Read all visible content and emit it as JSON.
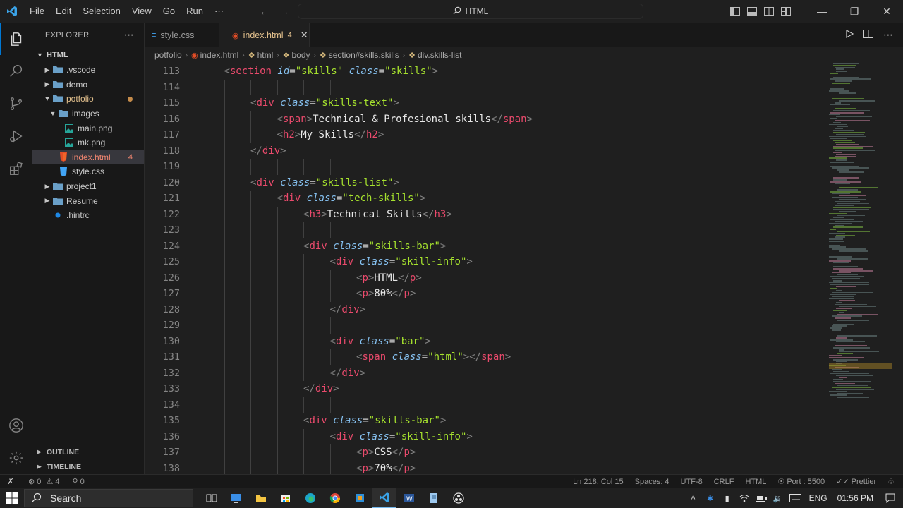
{
  "menu": [
    "File",
    "Edit",
    "Selection",
    "View",
    "Go",
    "Run",
    "···"
  ],
  "command_center": "HTML",
  "explorer": {
    "header": "EXPLORER",
    "root": "HTML",
    "items": [
      {
        "label": ".vscode",
        "type": "folder",
        "depth": 1,
        "expanded": false
      },
      {
        "label": "demo",
        "type": "folder",
        "depth": 1,
        "expanded": false
      },
      {
        "label": "potfolio",
        "type": "folder",
        "depth": 1,
        "expanded": true,
        "status": "modified"
      },
      {
        "label": "images",
        "type": "folder",
        "depth": 2,
        "expanded": true
      },
      {
        "label": "main.png",
        "type": "image",
        "depth": 3
      },
      {
        "label": "mk.png",
        "type": "image",
        "depth": 3
      },
      {
        "label": "index.html",
        "type": "html",
        "depth": 2,
        "badge": "4",
        "status": "error"
      },
      {
        "label": "style.css",
        "type": "css",
        "depth": 2
      },
      {
        "label": "project1",
        "type": "folder",
        "depth": 1,
        "expanded": false
      },
      {
        "label": "Resume",
        "type": "folder",
        "depth": 1,
        "expanded": false
      },
      {
        "label": ".hintrc",
        "type": "config",
        "depth": 1
      }
    ],
    "outline": "OUTLINE",
    "timeline": "TIMELINE"
  },
  "tabs": [
    {
      "label": "style.css",
      "active": false
    },
    {
      "label": "index.html",
      "count": "4",
      "active": true
    }
  ],
  "breadcrumb": [
    "potfolio",
    "index.html",
    "html",
    "body",
    "section#skills.skills",
    "div.skills-list"
  ],
  "code_lines": [
    {
      "n": "113",
      "indent": 1,
      "tokens": [
        [
          "b",
          "<"
        ],
        [
          "t",
          "section"
        ],
        [
          "s",
          " "
        ],
        [
          "a",
          "id"
        ],
        [
          "e",
          "="
        ],
        [
          "v",
          "\"skills\""
        ],
        [
          "s",
          " "
        ],
        [
          "a",
          "class"
        ],
        [
          "e",
          "="
        ],
        [
          "v",
          "\"skills\""
        ],
        [
          "b",
          ">"
        ]
      ]
    },
    {
      "n": "114",
      "indent": 0,
      "tokens": []
    },
    {
      "n": "115",
      "indent": 2,
      "tokens": [
        [
          "b",
          "<"
        ],
        [
          "t",
          "div"
        ],
        [
          "s",
          " "
        ],
        [
          "a",
          "class"
        ],
        [
          "e",
          "="
        ],
        [
          "v",
          "\"skills-text\""
        ],
        [
          "b",
          ">"
        ]
      ]
    },
    {
      "n": "116",
      "indent": 3,
      "tokens": [
        [
          "b",
          "<"
        ],
        [
          "t",
          "span"
        ],
        [
          "b",
          ">"
        ],
        [
          "x",
          "Technical & Profesional skills"
        ],
        [
          "b",
          "</"
        ],
        [
          "t",
          "span"
        ],
        [
          "b",
          ">"
        ]
      ]
    },
    {
      "n": "117",
      "indent": 3,
      "tokens": [
        [
          "b",
          "<"
        ],
        [
          "t",
          "h2"
        ],
        [
          "b",
          ">"
        ],
        [
          "x",
          "My Skills"
        ],
        [
          "b",
          "</"
        ],
        [
          "t",
          "h2"
        ],
        [
          "b",
          ">"
        ]
      ]
    },
    {
      "n": "118",
      "indent": 2,
      "tokens": [
        [
          "b",
          "</"
        ],
        [
          "t",
          "div"
        ],
        [
          "b",
          ">"
        ]
      ]
    },
    {
      "n": "119",
      "indent": 0,
      "tokens": []
    },
    {
      "n": "120",
      "indent": 2,
      "tokens": [
        [
          "b",
          "<"
        ],
        [
          "t",
          "div"
        ],
        [
          "s",
          " "
        ],
        [
          "a",
          "class"
        ],
        [
          "e",
          "="
        ],
        [
          "v",
          "\"skills-list\""
        ],
        [
          "b",
          ">"
        ]
      ]
    },
    {
      "n": "121",
      "indent": 3,
      "tokens": [
        [
          "b",
          "<"
        ],
        [
          "t",
          "div"
        ],
        [
          "s",
          " "
        ],
        [
          "a",
          "class"
        ],
        [
          "e",
          "="
        ],
        [
          "v",
          "\"tech-skills\""
        ],
        [
          "b",
          ">"
        ]
      ]
    },
    {
      "n": "122",
      "indent": 4,
      "tokens": [
        [
          "b",
          "<"
        ],
        [
          "t",
          "h3"
        ],
        [
          "b",
          ">"
        ],
        [
          "x",
          "Technical Skills"
        ],
        [
          "b",
          "</"
        ],
        [
          "t",
          "h3"
        ],
        [
          "b",
          ">"
        ]
      ]
    },
    {
      "n": "123",
      "indent": 0,
      "tokens": []
    },
    {
      "n": "124",
      "indent": 4,
      "tokens": [
        [
          "b",
          "<"
        ],
        [
          "t",
          "div"
        ],
        [
          "s",
          " "
        ],
        [
          "a",
          "class"
        ],
        [
          "e",
          "="
        ],
        [
          "v",
          "\"skills-bar\""
        ],
        [
          "b",
          ">"
        ]
      ]
    },
    {
      "n": "125",
      "indent": 5,
      "tokens": [
        [
          "b",
          "<"
        ],
        [
          "t",
          "div"
        ],
        [
          "s",
          " "
        ],
        [
          "a",
          "class"
        ],
        [
          "e",
          "="
        ],
        [
          "v",
          "\"skill-info\""
        ],
        [
          "b",
          ">"
        ]
      ]
    },
    {
      "n": "126",
      "indent": 6,
      "tokens": [
        [
          "b",
          "<"
        ],
        [
          "t",
          "p"
        ],
        [
          "b",
          ">"
        ],
        [
          "x",
          "HTML"
        ],
        [
          "b",
          "</"
        ],
        [
          "t",
          "p"
        ],
        [
          "b",
          ">"
        ]
      ]
    },
    {
      "n": "127",
      "indent": 6,
      "tokens": [
        [
          "b",
          "<"
        ],
        [
          "t",
          "p"
        ],
        [
          "b",
          ">"
        ],
        [
          "x",
          "80%"
        ],
        [
          "b",
          "</"
        ],
        [
          "t",
          "p"
        ],
        [
          "b",
          ">"
        ]
      ]
    },
    {
      "n": "128",
      "indent": 5,
      "tokens": [
        [
          "b",
          "</"
        ],
        [
          "t",
          "div"
        ],
        [
          "b",
          ">"
        ]
      ]
    },
    {
      "n": "129",
      "indent": 0,
      "tokens": []
    },
    {
      "n": "130",
      "indent": 5,
      "tokens": [
        [
          "b",
          "<"
        ],
        [
          "t",
          "div"
        ],
        [
          "s",
          " "
        ],
        [
          "a",
          "class"
        ],
        [
          "e",
          "="
        ],
        [
          "v",
          "\"bar\""
        ],
        [
          "b",
          ">"
        ]
      ]
    },
    {
      "n": "131",
      "indent": 6,
      "tokens": [
        [
          "b",
          "<"
        ],
        [
          "t",
          "span"
        ],
        [
          "s",
          " "
        ],
        [
          "a",
          "class"
        ],
        [
          "e",
          "="
        ],
        [
          "v",
          "\"html\""
        ],
        [
          "b",
          "></"
        ],
        [
          "t",
          "span"
        ],
        [
          "b",
          ">"
        ]
      ]
    },
    {
      "n": "132",
      "indent": 5,
      "tokens": [
        [
          "b",
          "</"
        ],
        [
          "t",
          "div"
        ],
        [
          "b",
          ">"
        ]
      ]
    },
    {
      "n": "133",
      "indent": 4,
      "tokens": [
        [
          "b",
          "</"
        ],
        [
          "t",
          "div"
        ],
        [
          "b",
          ">"
        ]
      ]
    },
    {
      "n": "134",
      "indent": 0,
      "tokens": []
    },
    {
      "n": "135",
      "indent": 4,
      "tokens": [
        [
          "b",
          "<"
        ],
        [
          "t",
          "div"
        ],
        [
          "s",
          " "
        ],
        [
          "a",
          "class"
        ],
        [
          "e",
          "="
        ],
        [
          "v",
          "\"skills-bar\""
        ],
        [
          "b",
          ">"
        ]
      ]
    },
    {
      "n": "136",
      "indent": 5,
      "tokens": [
        [
          "b",
          "<"
        ],
        [
          "t",
          "div"
        ],
        [
          "s",
          " "
        ],
        [
          "a",
          "class"
        ],
        [
          "e",
          "="
        ],
        [
          "v",
          "\"skill-info\""
        ],
        [
          "b",
          ">"
        ]
      ]
    },
    {
      "n": "137",
      "indent": 6,
      "tokens": [
        [
          "b",
          "<"
        ],
        [
          "t",
          "p"
        ],
        [
          "b",
          ">"
        ],
        [
          "x",
          "CSS"
        ],
        [
          "b",
          "</"
        ],
        [
          "t",
          "p"
        ],
        [
          "b",
          ">"
        ]
      ]
    },
    {
      "n": "138",
      "indent": 6,
      "tokens": [
        [
          "b",
          "<"
        ],
        [
          "t",
          "p"
        ],
        [
          "b",
          ">"
        ],
        [
          "x",
          "70%"
        ],
        [
          "b",
          "</"
        ],
        [
          "t",
          "p"
        ],
        [
          "b",
          ">"
        ]
      ]
    }
  ],
  "status": {
    "errors": "0",
    "warnings": "4",
    "ports": "0",
    "position": "Ln 218, Col 15",
    "spaces": "Spaces: 4",
    "encoding": "UTF-8",
    "eol": "CRLF",
    "language": "HTML",
    "port": "Port : 5500",
    "prettier": "Prettier"
  },
  "taskbar": {
    "search_placeholder": "Search",
    "lang": "ENG",
    "time": "01:56 PM"
  },
  "colors": {
    "accent": "#0078d4",
    "tag": "#ea4a6c",
    "attr": "#86c1f0",
    "string": "#a6e22e",
    "modified": "#e2c08d",
    "error": "#f48771"
  }
}
